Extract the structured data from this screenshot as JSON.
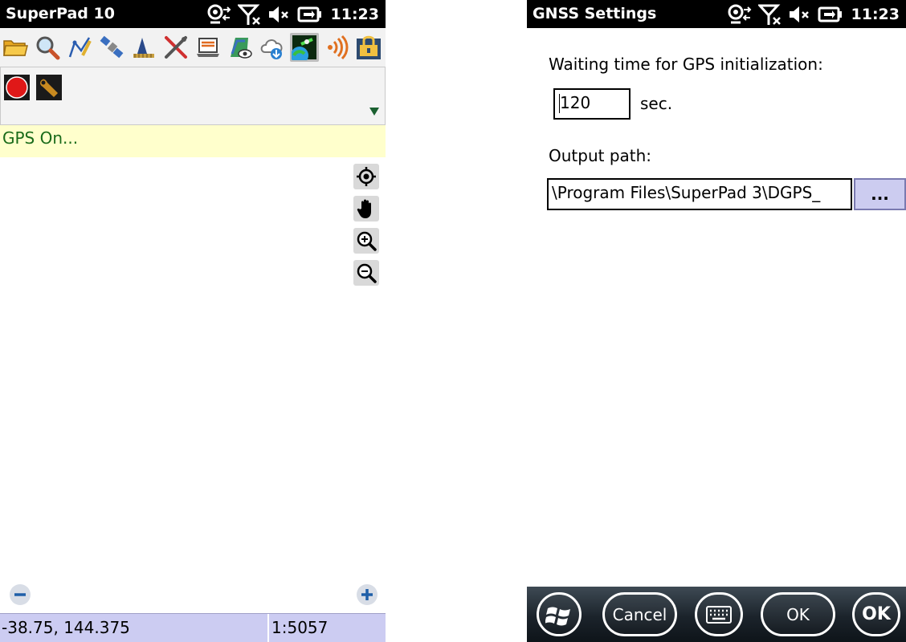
{
  "left_screen": {
    "title": "SuperPad 10",
    "clock": "11:23",
    "toolbar": {
      "icons": [
        "open-folder-icon",
        "search-icon",
        "draw-polyline-icon",
        "gps-satellite-icon",
        "survey-icon",
        "tools-icon",
        "laptop-icon",
        "map-view-icon",
        "cloud-download-icon",
        "gnss-icon",
        "signal-icon",
        "lock-layout-icon"
      ]
    },
    "status_text": "GPS On...",
    "coordinates": "-38.75, 144.375",
    "scale": "1:5057"
  },
  "right_screen": {
    "title": "GNSS Settings",
    "clock": "11:23",
    "wait_label": "Waiting time for GPS initialization:",
    "wait_value": "120",
    "wait_unit": "sec.",
    "output_label": "Output path:",
    "output_path": "\\Program Files\\SuperPad 3\\DGPS_",
    "browse_label": "...",
    "softkeys": {
      "cancel": "Cancel",
      "ok": "OK",
      "ok_right": "OK"
    }
  },
  "colors": {
    "status_bar": "#000000",
    "gps_banner": "#ffffcc",
    "gps_text": "#1a6b1a",
    "coord_bar": "#ccccf2",
    "browse_button": "#ccccf0"
  }
}
